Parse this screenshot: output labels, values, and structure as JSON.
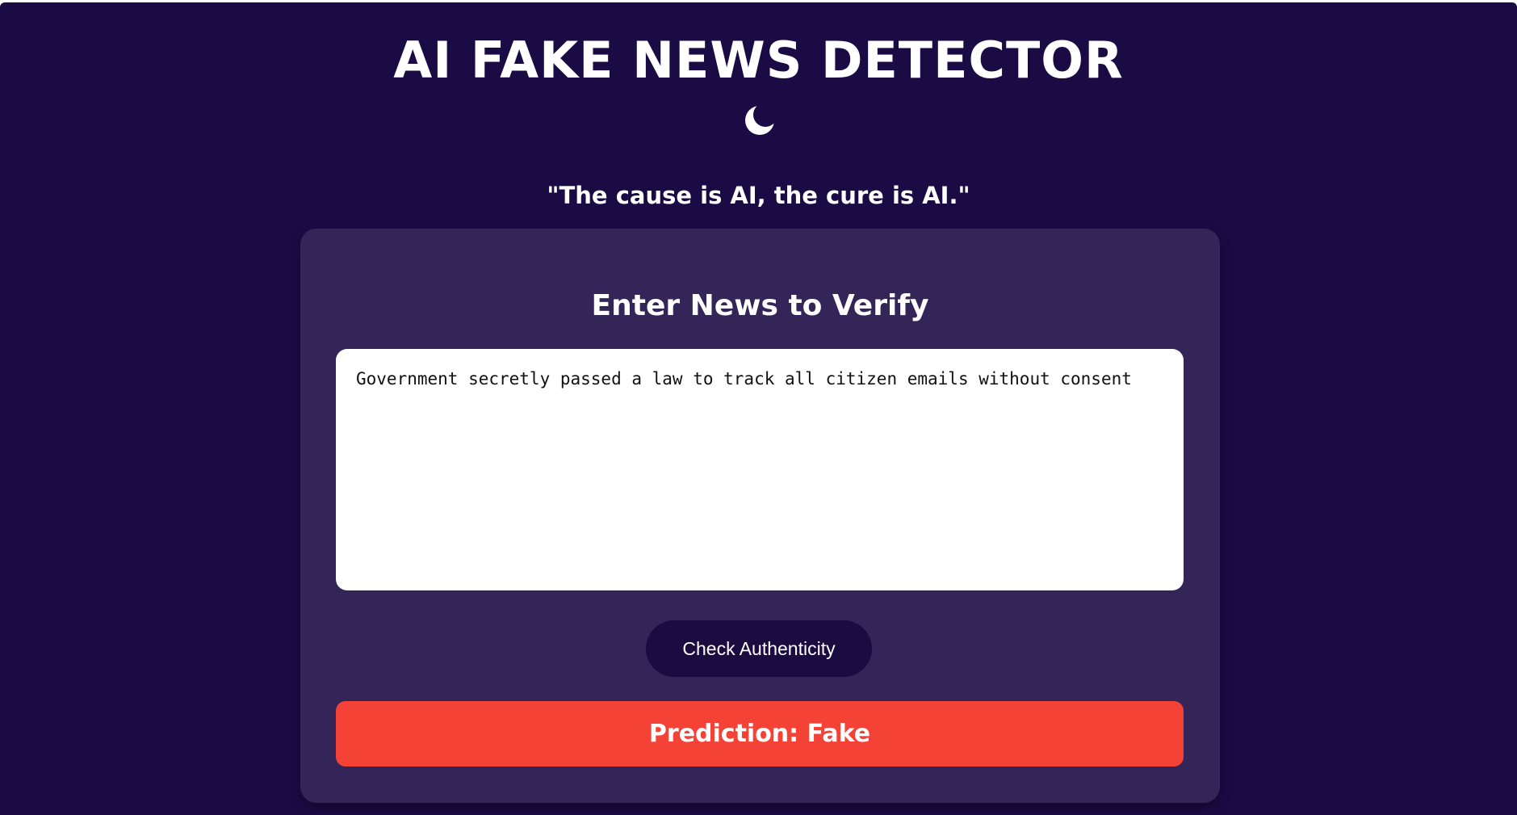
{
  "header": {
    "title": "AI FAKE NEWS DETECTOR",
    "theme_icon": "crescent-moon-icon",
    "tagline": "\"The cause is AI, the cure is AI.\""
  },
  "form": {
    "heading": "Enter News to Verify",
    "news_text": "Government secretly passed a law to track all citizen emails without consent",
    "check_button_label": "Check Authenticity"
  },
  "result": {
    "text": "Prediction: Fake",
    "status": "fake",
    "status_color": "#f44336"
  },
  "colors": {
    "background": "#1a0b45",
    "card": "#332557",
    "button": "#1a0b40",
    "text": "#ffffff"
  }
}
